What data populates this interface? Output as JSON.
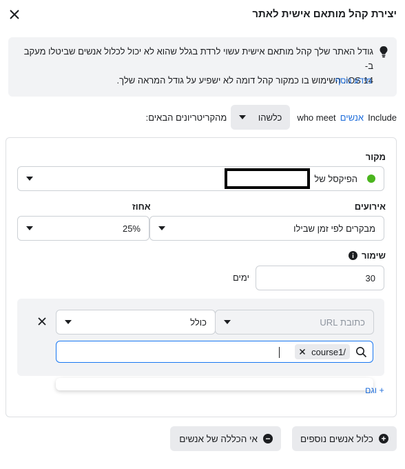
{
  "dialog": {
    "title": "יצירת קהל מותאם אישית לאתר"
  },
  "info": {
    "line1": "גודל האתר שלך קהל מותאם אישית עשוי לרדת בגלל שהוא לא יכול לכלול אנשים שביטלו מעקב ב-",
    "line2": "iOS 14. השימוש בו כמקור קהל דומה לא ישפיע על גודל המראה שלך.",
    "more_link": "מידע נוסף"
  },
  "include_row": {
    "include_word": "Include",
    "people_link": "אנשים",
    "who_meet": "who meet",
    "any_selector": "כלשהו",
    "criteria_text": "מהקריטריונים הבאים:"
  },
  "source": {
    "label": "מקור",
    "value": "הפיקסל של"
  },
  "events": {
    "label": "אירועים",
    "value": "מבקרים לפי זמן שבילו"
  },
  "percentage": {
    "label": "אחוז",
    "value": "25%"
  },
  "retention": {
    "label": "שימור",
    "value": "30",
    "unit": "ימים"
  },
  "condition": {
    "field_placeholder": "כתובת URL",
    "operator": "כולל",
    "chip_value": "/course1"
  },
  "add_more": "+ וגם",
  "buttons": {
    "include_more": "כלול אנשים נוספים",
    "exclude": "אי הכללה של אנשים"
  }
}
